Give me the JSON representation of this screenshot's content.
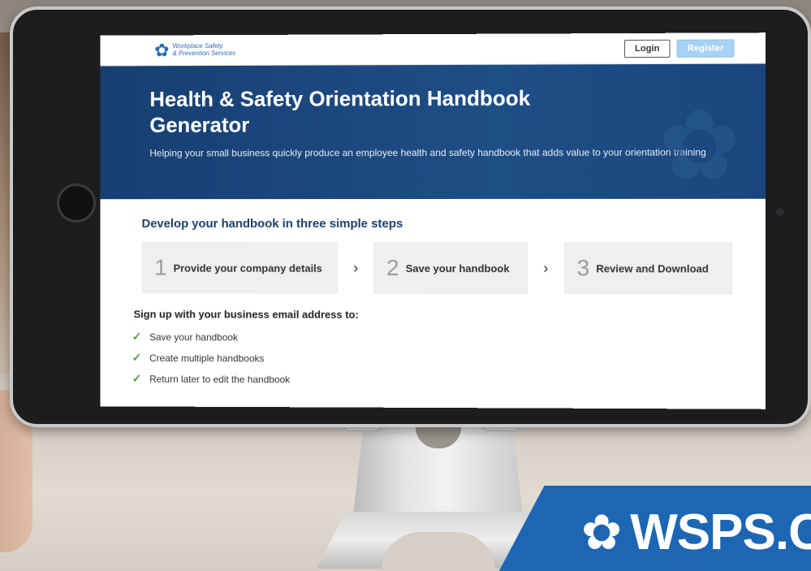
{
  "brand": {
    "logo_line1": "Workplace Safety",
    "logo_line2": "& Prevention Services",
    "logo_icon": "trillium-logo-icon",
    "banner_text": "WSPS.C"
  },
  "header": {
    "login_label": "Login",
    "register_label": "Register"
  },
  "hero": {
    "title": "Health & Safety Orientation Handbook Generator",
    "subtitle": "Helping your small business quickly produce an employee health and safety handbook that adds value to your orientation training"
  },
  "steps": {
    "heading": "Develop your handbook in three simple steps",
    "items": [
      {
        "num": "1",
        "label": "Provide your company details"
      },
      {
        "num": "2",
        "label": "Save your handbook"
      },
      {
        "num": "3",
        "label": "Review and Download"
      }
    ]
  },
  "signup": {
    "heading": "Sign up with your business email address to:",
    "benefits": [
      "Save your handbook",
      "Create multiple handbooks",
      "Return later to edit the handbook"
    ]
  },
  "colors": {
    "hero_blue": "#1e4e86",
    "brand_blue": "#1d66b3",
    "register_blue": "#a6d2f3",
    "check_green": "#4a9a3a"
  }
}
